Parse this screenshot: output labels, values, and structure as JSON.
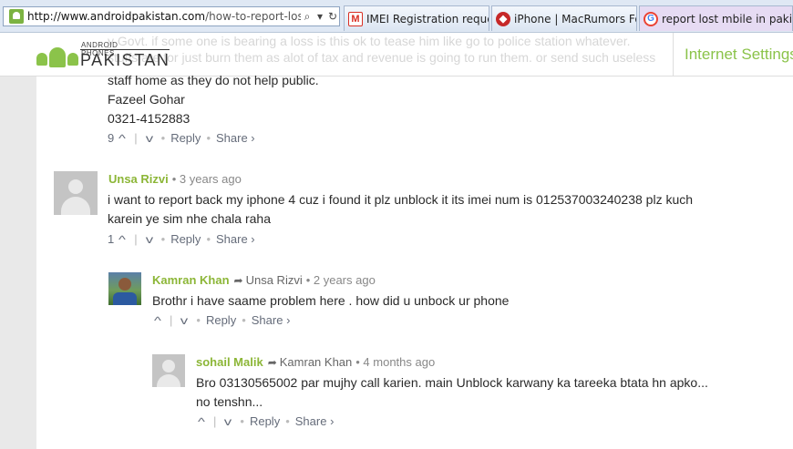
{
  "browser": {
    "address_domain": "http://www.androidpakistan.com",
    "address_path": "/how-to-report-lost-",
    "tabs": [
      {
        "label": "IMEI Registration reque...",
        "icon": "gmail-icon"
      },
      {
        "label": "iPhone | MacRumors Fo...",
        "icon": "macrumors-icon"
      },
      {
        "label": "report lost mbile in paki...",
        "icon": "google-icon"
      }
    ]
  },
  "site": {
    "brand_small": "ANDROID PHONES",
    "brand_big": "PAKISTAN",
    "internet_settings": "Internet Settings"
  },
  "ghost_text": {
    "line1": "y Govt. if some one is bearing a loss is this ok to tease him like go to police station whatever.",
    "line2": "stuffs are for just burn them as alot of tax and revenue is going to run them. or send such useless"
  },
  "comment0": {
    "lines": [
      "staff home as they do not help public.",
      "Fazeel Gohar",
      "0321-4152883"
    ],
    "upvotes": "9",
    "reply": "Reply",
    "share": "Share ›"
  },
  "comment1": {
    "author": "Unsa Rizvi",
    "time": "• 3 years ago",
    "line1": "i want to report back my iphone 4 cuz i found it plz unblock it its imei num is 012537003240238 plz kuch",
    "line2": "karein ye sim nhe chala raha",
    "upvotes": "1",
    "reply": "Reply",
    "share": "Share ›"
  },
  "comment2": {
    "author": "Kamran Khan",
    "parent": "Unsa Rizvi",
    "time": "• 2 years ago",
    "line1": "Brothr i have saame problem here . how did u unbock ur phone",
    "reply": "Reply",
    "share": "Share ›"
  },
  "comment3": {
    "author": "sohail Malik",
    "parent": "Kamran Khan",
    "time": "• 4 months ago",
    "line1": "Bro 03130565002 par mujhy call karien. main Unblock karwany ka tareeka btata hn apko...",
    "line2": "no tenshn...",
    "reply": "Reply",
    "share": "Share ›"
  },
  "colors": {
    "author": "#8cb637",
    "brand_green": "#8bc34a",
    "text": "#2a2a2a",
    "meta": "#888888"
  }
}
